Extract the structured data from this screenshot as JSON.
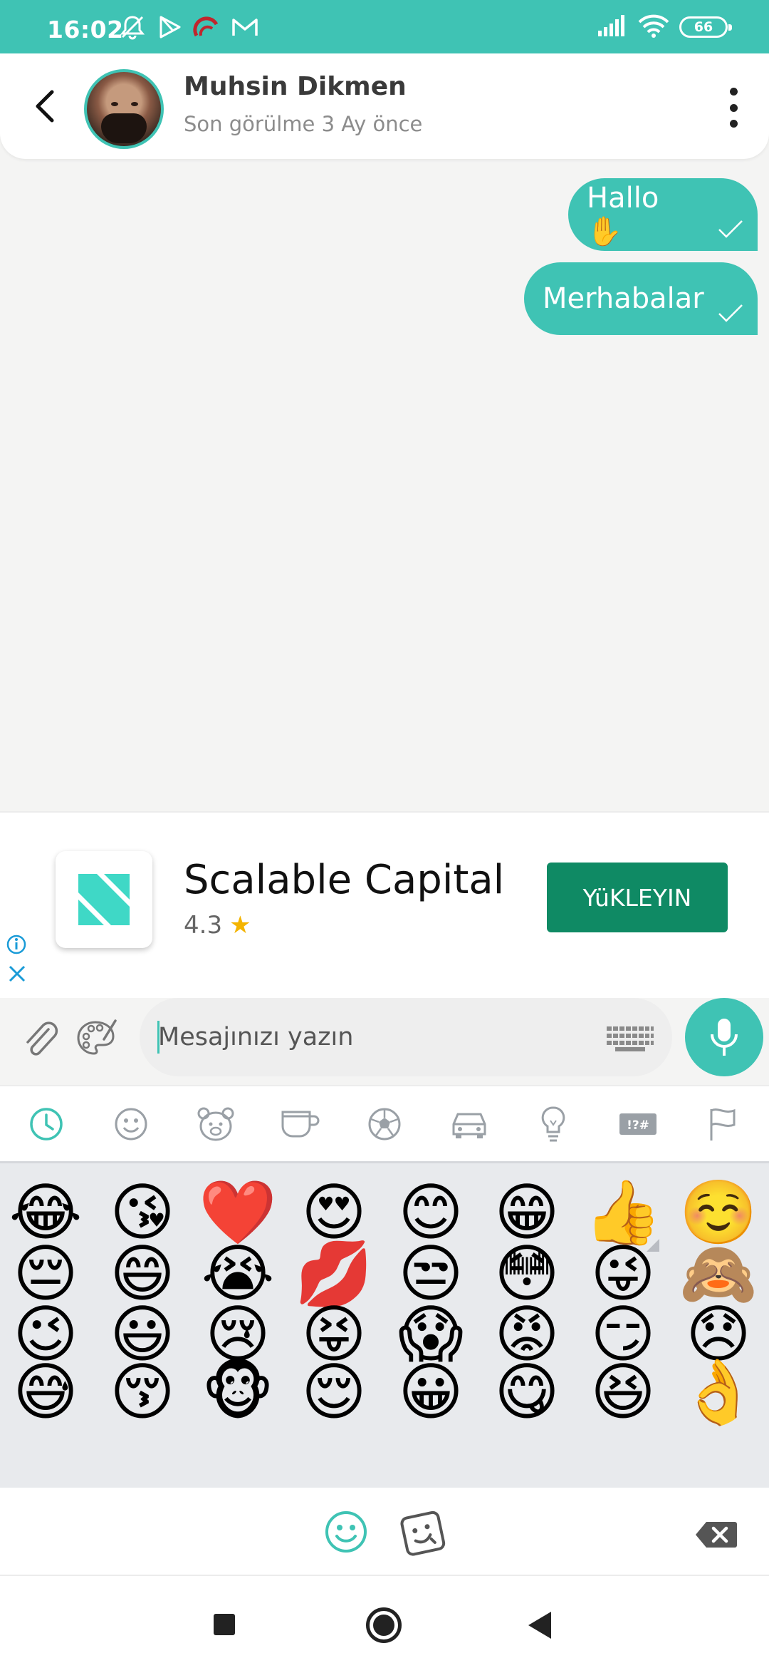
{
  "status_bar": {
    "time": "16:02",
    "battery": "66",
    "icons": [
      "mute-icon",
      "play-store-icon",
      "shield-app-icon",
      "gmail-icon",
      "signal-icon",
      "wifi-icon",
      "battery-icon"
    ]
  },
  "header": {
    "contact_name": "Muhsin Dikmen",
    "last_seen": "Son görülme 3 Ay önce"
  },
  "messages": [
    {
      "text": "Hallo ✋",
      "status": "sent"
    },
    {
      "text": "Merhabalar",
      "status": "sent"
    }
  ],
  "ad": {
    "title": "Scalable Capital",
    "rating": "4.3",
    "button": "YüKLEYIN"
  },
  "composer": {
    "placeholder": "Mesajınızı yazın"
  },
  "emoji_tabs": [
    "recent-icon",
    "smileys-icon",
    "animals-icon",
    "food-icon",
    "sports-icon",
    "travel-icon",
    "objects-icon",
    "symbols-icon",
    "flags-icon"
  ],
  "emojis": [
    [
      "😂",
      "😘",
      "❤️",
      "😍",
      "😊",
      "😁",
      "👍",
      "☺️"
    ],
    [
      "😔",
      "😄",
      "😭",
      "💋",
      "😒",
      "😳",
      "😜",
      "🙈"
    ],
    [
      "😉",
      "😃",
      "😢",
      "😝",
      "😱",
      "😡",
      "😏",
      "😞"
    ],
    [
      "😅",
      "😚",
      "🐵",
      "😌",
      "😀",
      "😋",
      "😆",
      "👌"
    ]
  ],
  "colors": {
    "accent": "#3fc3b4",
    "ad_button": "#0f8a64",
    "background": "#f4f4f3"
  }
}
